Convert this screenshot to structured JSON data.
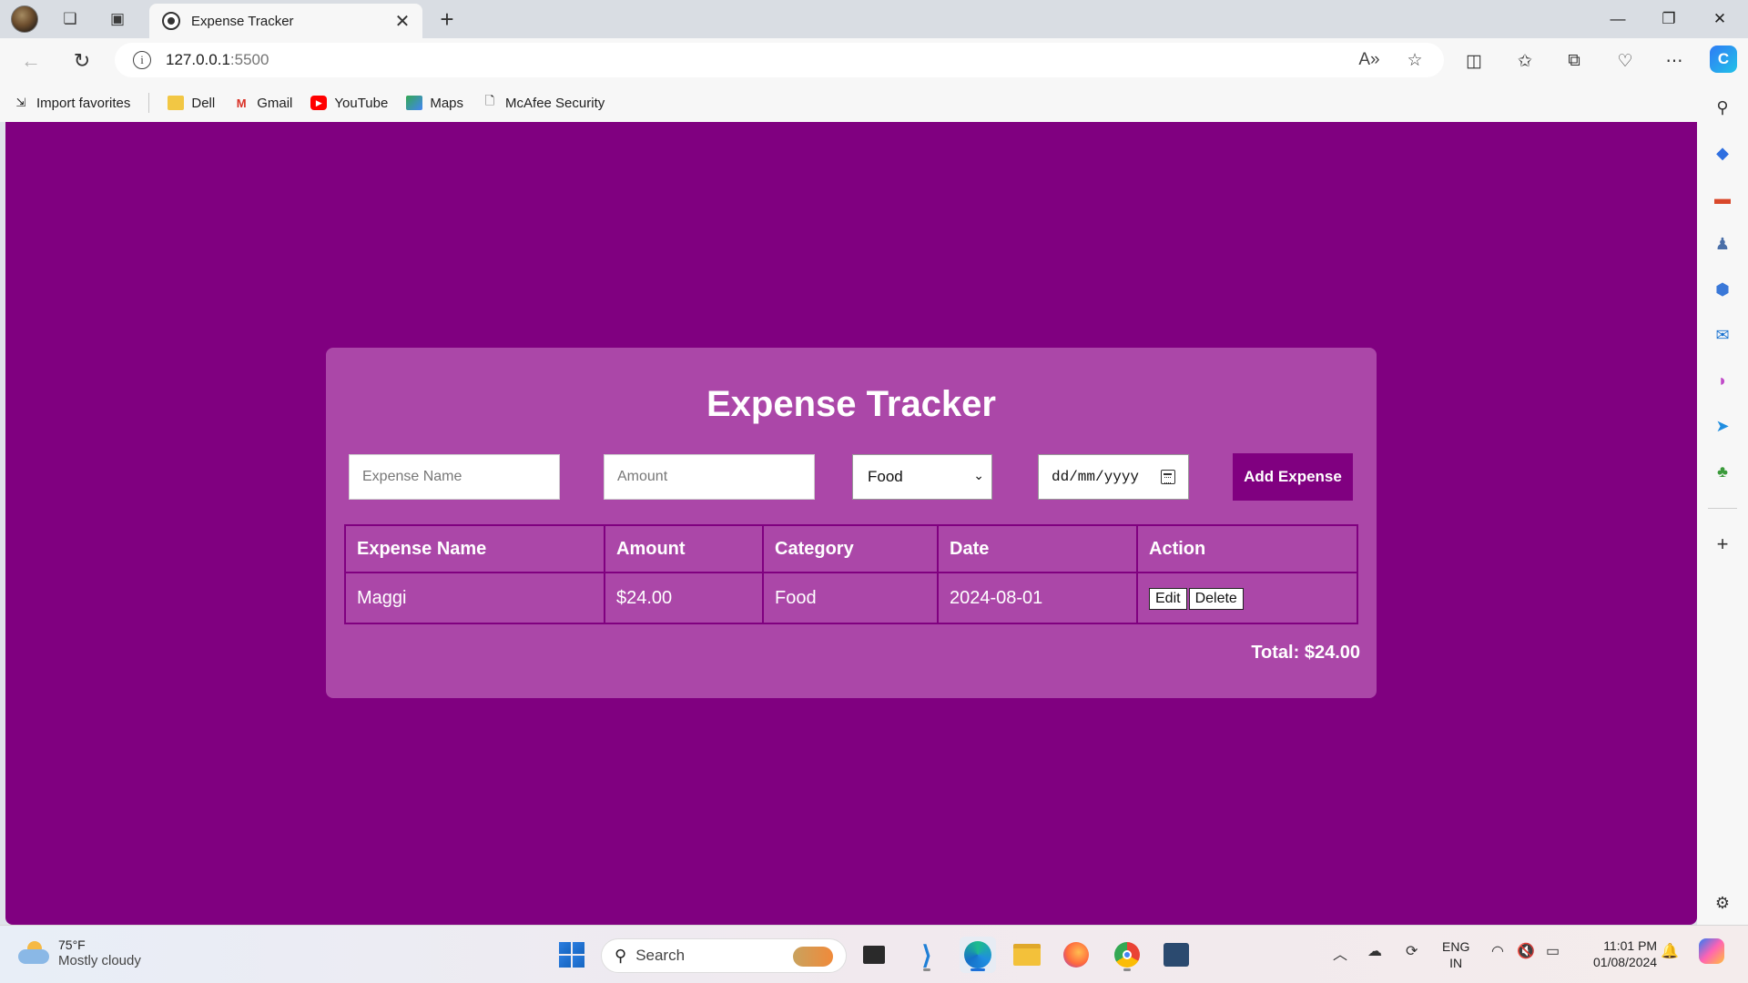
{
  "browser": {
    "tab_title": "Expense Tracker",
    "tab_close": "✕",
    "new_tab": "+",
    "url_host": "127.0.0.1",
    "url_port": ":5500",
    "window": {
      "minimize": "—",
      "restore": "❐",
      "close": "✕"
    }
  },
  "bookmarks": [
    {
      "label": "Import favorites"
    },
    {
      "label": "Dell"
    },
    {
      "label": "Gmail"
    },
    {
      "label": "YouTube"
    },
    {
      "label": "Maps"
    },
    {
      "label": "McAfee Security"
    }
  ],
  "app": {
    "title": "Expense Tracker",
    "form": {
      "name_placeholder": "Expense Name",
      "amount_placeholder": "Amount",
      "category_selected": "Food",
      "date_placeholder": "dd/mm/yyyy",
      "add_button": "Add Expense"
    },
    "table": {
      "headers": [
        "Expense Name",
        "Amount",
        "Category",
        "Date",
        "Action"
      ],
      "rows": [
        {
          "name": "Maggi",
          "amount": "$24.00",
          "category": "Food",
          "date": "2024-08-01",
          "edit": "Edit",
          "delete": "Delete"
        }
      ]
    },
    "total": "Total: $24.00"
  },
  "taskbar": {
    "weather_temp": "75°F",
    "weather_cond": "Mostly cloudy",
    "search_label": "Search",
    "lang_top": "ENG",
    "lang_bottom": "IN",
    "time": "11:01 PM",
    "date": "01/08/2024"
  },
  "colors": {
    "page_bg": "#800080",
    "card_bg": "#ab47a8",
    "button_bg": "#800080"
  }
}
